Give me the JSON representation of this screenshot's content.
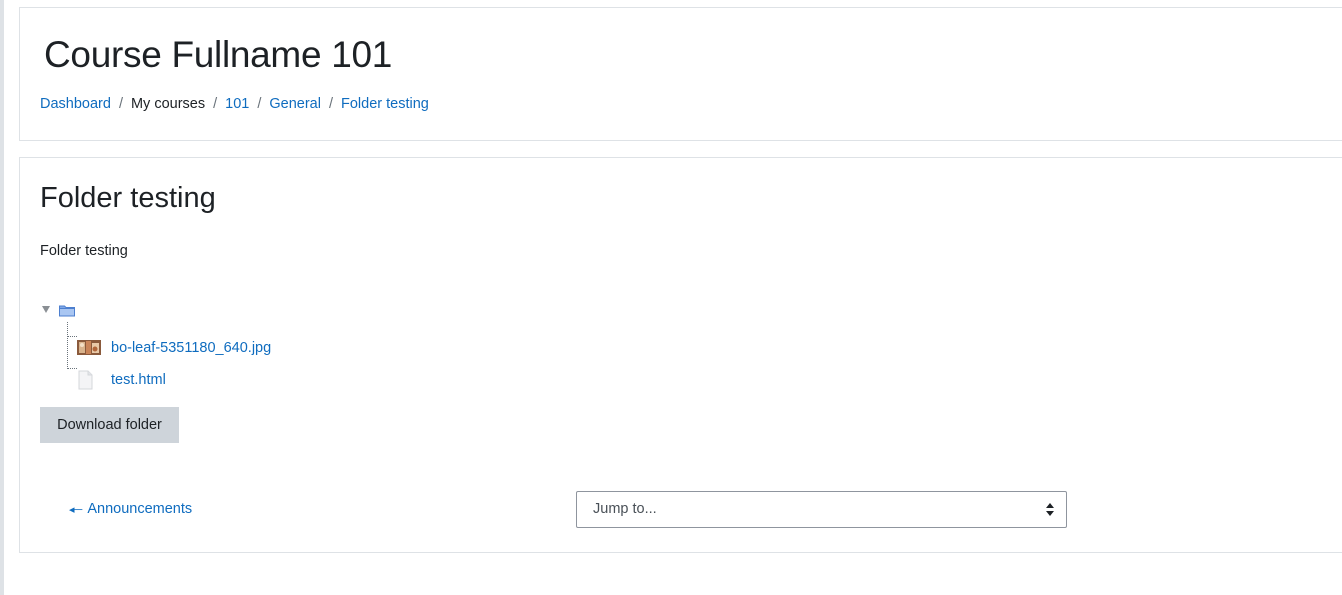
{
  "header": {
    "course_title": "Course Fullname 101",
    "breadcrumb": {
      "items": [
        "Dashboard",
        "My courses",
        "101",
        "General",
        "Folder testing"
      ],
      "separator": "/"
    }
  },
  "main": {
    "title": "Folder testing",
    "intro": "Folder testing",
    "tree": {
      "root_icon": "folder-icon",
      "files": [
        {
          "name": "bo-leaf-5351180_640.jpg",
          "icon": "image-file-icon"
        },
        {
          "name": "test.html",
          "icon": "generic-file-icon"
        }
      ]
    },
    "download_label": "Download folder",
    "nav": {
      "prev_label": "Announcements",
      "prev_icon": "arrow-left-icon",
      "jump_label": "Jump to..."
    }
  },
  "colors": {
    "link": "#0f6cbf",
    "text": "#1d2125",
    "button_bg": "#ced4da",
    "border": "#dee2e6"
  }
}
